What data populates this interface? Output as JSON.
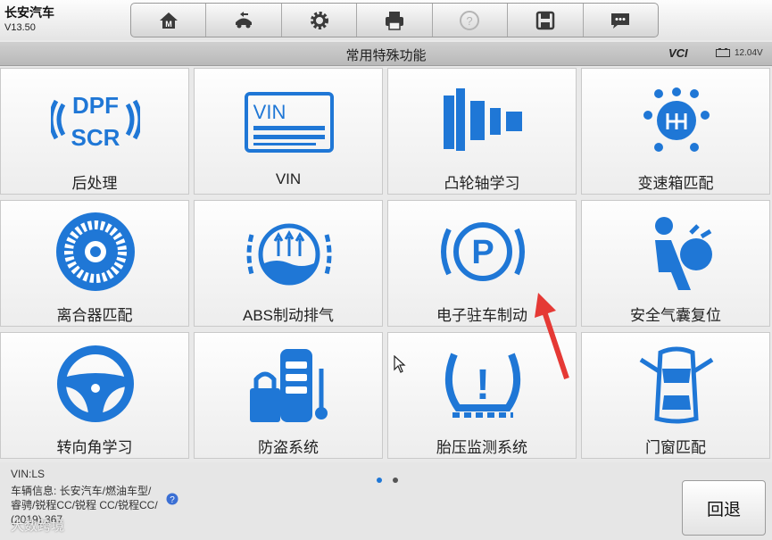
{
  "app": {
    "title": "长安汽车",
    "version": "V13.50"
  },
  "toolbar": {
    "buttons": [
      {
        "icon": "home-icon"
      },
      {
        "icon": "vehicle-swap-icon"
      },
      {
        "icon": "gear-icon"
      },
      {
        "icon": "printer-icon"
      },
      {
        "icon": "help-icon"
      },
      {
        "icon": "save-icon"
      },
      {
        "icon": "chat-icon"
      }
    ]
  },
  "titlebar": {
    "title": "常用特殊功能",
    "vci": "VCI",
    "voltage": "12.04V"
  },
  "tiles": [
    {
      "label": "后处理",
      "icon": "dpf-scr-icon"
    },
    {
      "label": "VIN",
      "icon": "vin-card-icon"
    },
    {
      "label": "凸轮轴学习",
      "icon": "camshaft-icon"
    },
    {
      "label": "变速箱匹配",
      "icon": "gearbox-icon"
    },
    {
      "label": "离合器匹配",
      "icon": "clutch-icon"
    },
    {
      "label": "ABS制动排气",
      "icon": "abs-bleed-icon"
    },
    {
      "label": "电子驻车制动",
      "icon": "parking-brake-icon"
    },
    {
      "label": "安全气囊复位",
      "icon": "airbag-icon"
    },
    {
      "label": "转向角学习",
      "icon": "steering-wheel-icon"
    },
    {
      "label": "防盗系统",
      "icon": "immobilizer-icon"
    },
    {
      "label": "胎压监测系统",
      "icon": "tpms-icon"
    },
    {
      "label": "门窗匹配",
      "icon": "door-window-icon"
    }
  ],
  "icon_text": {
    "dpf": "DPF",
    "scr": "SCR",
    "vin": "VIN",
    "park": "P",
    "tpms": "!"
  },
  "footer": {
    "vin": "VIN:LS",
    "vehicle_info": "车辆信息: 长安汽车/燃油车型/睿骋/锐程CC/锐程 CC/锐程CC/ (2019) 367",
    "back_label": "回退",
    "watermark": "大数跨境"
  },
  "colors": {
    "accent": "#1f77d6",
    "toolbar_bg": "#e4e4e4",
    "page_bg": "#e9e9e9",
    "arrow": "#e53935"
  }
}
